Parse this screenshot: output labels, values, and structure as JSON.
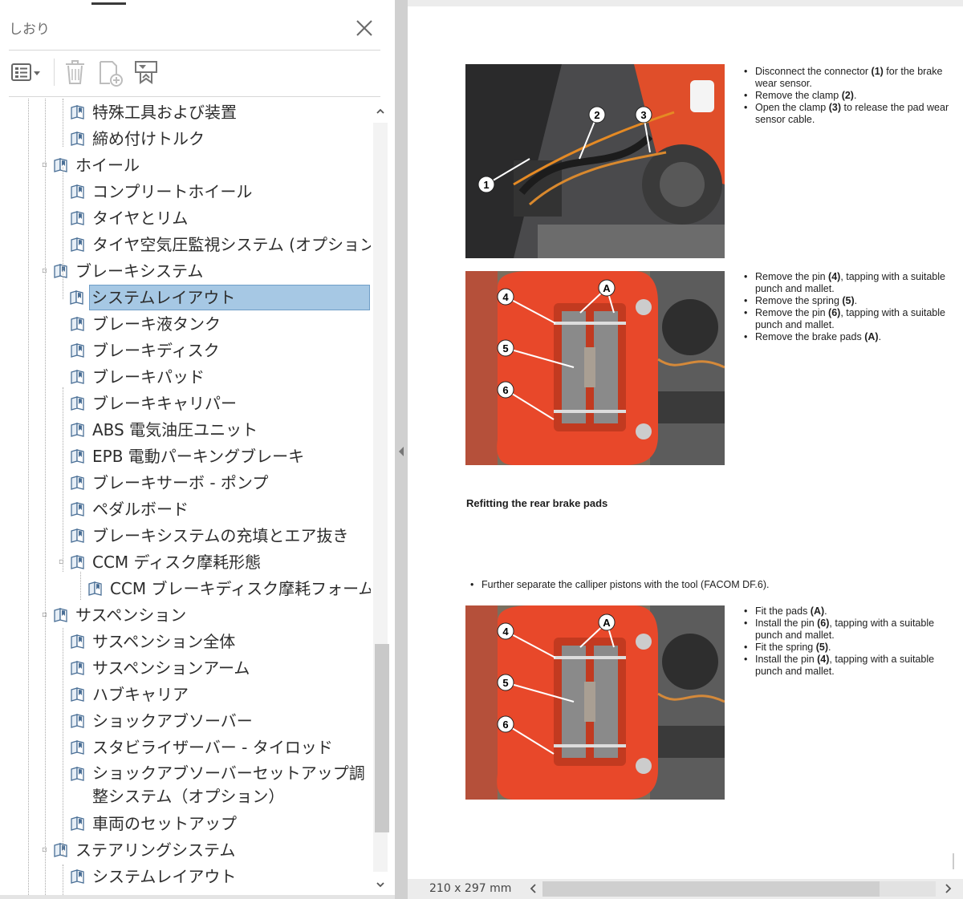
{
  "panel": {
    "title": "しおり",
    "toolbar": {
      "options": "options-icon",
      "delete": "trash-icon",
      "add": "add-bookmark-icon",
      "expand": "expand-bookmark-icon"
    }
  },
  "bookmarks": [
    {
      "label": "特殊工具および装置",
      "depth": 2
    },
    {
      "label": "締め付けトルク",
      "depth": 2
    },
    {
      "label": "ホイール",
      "depth": 1,
      "expandable": true
    },
    {
      "label": "コンプリートホイール",
      "depth": 2
    },
    {
      "label": "タイヤとリム",
      "depth": 2
    },
    {
      "label": "タイヤ空気圧監視システム (オプション)",
      "depth": 2
    },
    {
      "label": "ブレーキシステム",
      "depth": 1,
      "expandable": true
    },
    {
      "label": "システムレイアウト",
      "depth": 2,
      "selected": true
    },
    {
      "label": "ブレーキ液タンク",
      "depth": 2
    },
    {
      "label": "ブレーキディスク",
      "depth": 2
    },
    {
      "label": "ブレーキパッド",
      "depth": 2
    },
    {
      "label": "ブレーキキャリパー",
      "depth": 2
    },
    {
      "label": "ABS 電気油圧ユニット",
      "depth": 2
    },
    {
      "label": "EPB 電動パーキングブレーキ",
      "depth": 2
    },
    {
      "label": "ブレーキサーボ - ポンプ",
      "depth": 2
    },
    {
      "label": "ペダルボード",
      "depth": 2
    },
    {
      "label": "ブレーキシステムの充填とエア抜き",
      "depth": 2
    },
    {
      "label": "CCM ディスク摩耗形態",
      "depth": 2,
      "expandable": true
    },
    {
      "label": "CCM ブレーキディスク摩耗フォーム",
      "depth": 3
    },
    {
      "label": "サスペンション",
      "depth": 1,
      "expandable": true
    },
    {
      "label": "サスペンション全体",
      "depth": 2
    },
    {
      "label": "サスペンションアーム",
      "depth": 2
    },
    {
      "label": "ハブキャリア",
      "depth": 2
    },
    {
      "label": "ショックアブソーバー",
      "depth": 2
    },
    {
      "label": "スタビライザーバー - タイロッド",
      "depth": 2
    },
    {
      "label": "ショックアブソーバーセットアップ調整システム（オプション）",
      "depth": 2,
      "wrapped": true
    },
    {
      "label": "車両のセットアップ",
      "depth": 2
    },
    {
      "label": "ステアリングシステム",
      "depth": 1,
      "expandable": true
    },
    {
      "label": "システムレイアウト",
      "depth": 2
    }
  ],
  "document": {
    "block1": [
      {
        "text": "Disconnect the connector ",
        "ref": "(1)",
        "rest": " for the brake wear sensor."
      },
      {
        "text": "Remove the clamp ",
        "ref": "(2)",
        "rest": "."
      },
      {
        "text": "Open the clamp ",
        "ref": "(3)",
        "rest": " to release the pad wear sensor cable."
      }
    ],
    "block2": [
      {
        "text": "Remove the pin ",
        "ref": "(4)",
        "rest": ", tapping with a suitable punch and mallet."
      },
      {
        "text": "Remove the spring ",
        "ref": "(5)",
        "rest": "."
      },
      {
        "text": "Remove the pin ",
        "ref": "(6)",
        "rest": ", tapping with a suitable punch and mallet."
      },
      {
        "text": "Remove the brake pads ",
        "ref": "(A)",
        "rest": "."
      }
    ],
    "section_title": "Refitting the rear brake pads",
    "block3": [
      {
        "text": "Further separate the calliper pistons with the tool (FACOM DF.6).",
        "ref": "",
        "rest": ""
      }
    ],
    "block4": [
      {
        "text": "Fit the pads ",
        "ref": "(A)",
        "rest": "."
      },
      {
        "text": "Install the pin ",
        "ref": "(6)",
        "rest": ", tapping with a suitable punch and mallet."
      },
      {
        "text": "Fit the spring ",
        "ref": "(5)",
        "rest": "."
      },
      {
        "text": "Install the pin ",
        "ref": "(4)",
        "rest": ", tapping with a suitable punch and mallet."
      }
    ],
    "photo1_callouts": [
      "1",
      "2",
      "3"
    ],
    "photo2_callouts": [
      "A",
      "4",
      "5",
      "6"
    ],
    "photo3_callouts": [
      "A",
      "4",
      "5",
      "6"
    ]
  },
  "status": {
    "page_size": "210 x 297 mm"
  },
  "colors": {
    "selection": "#a6c8e4",
    "caliper": "#e8482a",
    "splitter": "#d0d0d0"
  }
}
